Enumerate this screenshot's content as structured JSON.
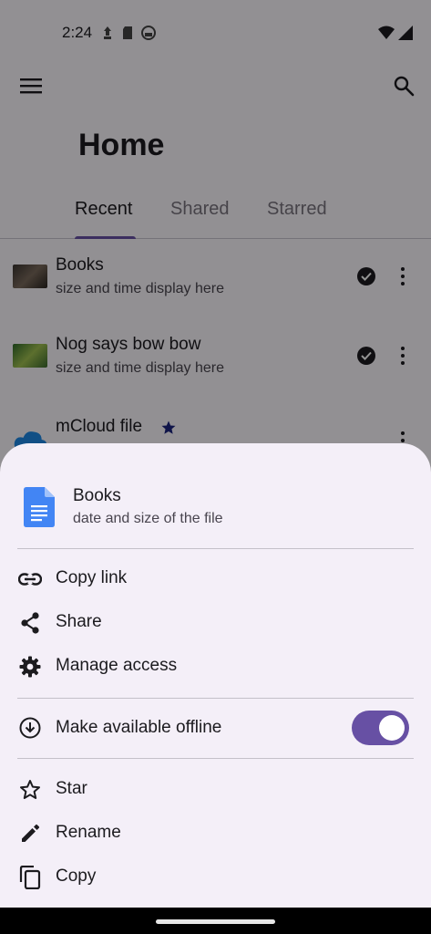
{
  "status_bar": {
    "time": "2:24"
  },
  "app": {
    "title": "Home",
    "tabs": [
      {
        "label": "Recent",
        "active": true
      },
      {
        "label": "Shared",
        "active": false
      },
      {
        "label": "Starred",
        "active": false
      }
    ],
    "files": [
      {
        "name": "Books",
        "meta": "size and time display here",
        "synced": true
      },
      {
        "name": "Nog says bow bow",
        "meta": "size and time display here",
        "synced": true
      },
      {
        "name": "mCloud file",
        "meta": "",
        "starred": true
      }
    ]
  },
  "sheet": {
    "file_name": "Books",
    "file_meta": "date and size of the file",
    "actions_group1": [
      {
        "label": "Copy link",
        "icon": "link-icon"
      },
      {
        "label": "Share",
        "icon": "share-icon"
      },
      {
        "label": "Manage access",
        "icon": "gear-icon"
      }
    ],
    "offline": {
      "label": "Make available offline",
      "icon": "download-circle-icon",
      "enabled": true
    },
    "actions_group2": [
      {
        "label": "Star",
        "icon": "star-outline-icon"
      },
      {
        "label": "Rename",
        "icon": "pencil-icon"
      },
      {
        "label": "Copy",
        "icon": "copy-icon"
      }
    ]
  },
  "colors": {
    "accent": "#6750a4",
    "sheet_bg": "#f4eff8",
    "doc_blue": "#4285f4",
    "star_blue": "#1a237e"
  }
}
